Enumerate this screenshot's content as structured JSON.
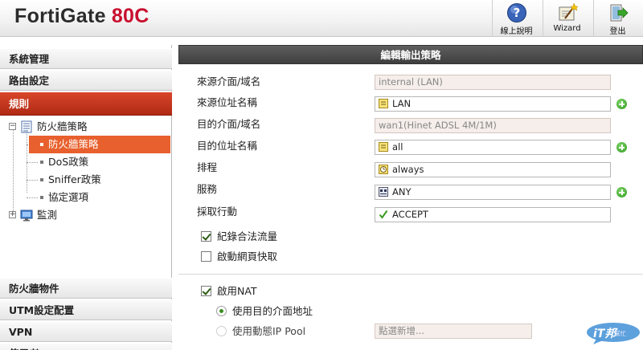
{
  "header": {
    "brand_name": "FortiGate",
    "brand_model": "80C",
    "buttons": [
      {
        "label": "線上說明",
        "icon": "help-icon"
      },
      {
        "label": "Wizard",
        "icon": "wizard-icon"
      },
      {
        "label": "登出",
        "icon": "logout-icon"
      }
    ]
  },
  "sidebar": {
    "menus": {
      "system": "系統管理",
      "routing": "路由設定",
      "policy": "規則",
      "fw_objects": "防火牆物件",
      "utm": "UTM設定配置",
      "vpn": "VPN",
      "more": "使用者"
    },
    "tree": {
      "firewall": "防火牆策略",
      "firewall_policy": "防火牆策略",
      "dos": "DoS政策",
      "sniffer": "Sniffer政策",
      "protocol": "協定選項",
      "monitor": "監測"
    }
  },
  "form": {
    "title": "編輯輸出策略",
    "src_intf_label": "來源介面/域名",
    "src_intf_value": "internal (LAN)",
    "src_addr_label": "來源位址名稱",
    "src_addr_value": "LAN",
    "dst_intf_label": "目的介面/域名",
    "dst_intf_value": "wan1(Hinet ADSL 4M/1M)",
    "dst_addr_label": "目的位址名稱",
    "dst_addr_value": "all",
    "schedule_label": "排程",
    "schedule_value": "always",
    "service_label": "服務",
    "service_value": "ANY",
    "action_label": "採取行動",
    "action_value": "ACCEPT",
    "log_traffic_label": "紀錄合法流量",
    "log_traffic_checked": true,
    "web_cache_label": "啟動網頁快取",
    "web_cache_checked": false,
    "nat_label": "啟用NAT",
    "nat_checked": true,
    "use_dst_intf_label": "使用目的介面地址",
    "use_ippool_label": "使用動態IP Pool",
    "ippool_placeholder": "點選新增..."
  },
  "watermark": {
    "text": "iT邦",
    "sub": "幫忙"
  },
  "colors": {
    "accent_red": "#c8102e",
    "menu_active": "#c13a20",
    "tree_selected": "#e8602d",
    "add_green": "#2f9a1d"
  }
}
